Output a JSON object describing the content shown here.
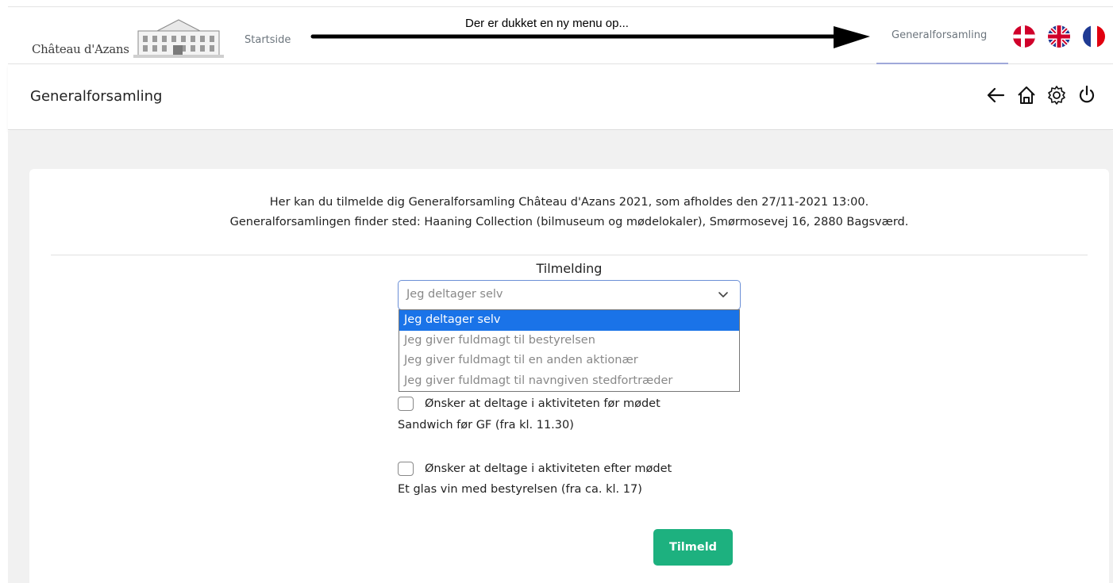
{
  "nav": {
    "logo_text": "Château d'Azans",
    "startside": "Startside",
    "active_item": "Generalforsamling",
    "annotation": "Der er dukket en ny menu op..."
  },
  "header": {
    "title": "Generalforsamling",
    "icons": [
      "back-arrow-icon",
      "home-icon",
      "settings-icon",
      "power-icon"
    ]
  },
  "intro": {
    "line1": "Her kan du tilmelde dig Generalforsamling Château d'Azans 2021, som afholdes den 27/11-2021 13:00.",
    "line2": "Generalforsamlingen finder sted: Haaning Collection (bilmuseum og mødelokaler), Smørmosevej 16, 2880 Bagsværd."
  },
  "form": {
    "tilmelding_label": "Tilmelding",
    "selected": "Jeg deltager selv",
    "options": [
      "Jeg deltager selv",
      "Jeg giver fuldmagt til bestyrelsen",
      "Jeg giver fuldmagt til en anden aktionær",
      "Jeg giver fuldmagt til navngiven stedfortræder"
    ],
    "activity_before": {
      "label": "Ønsker at deltage i aktiviteten før mødet",
      "desc": "Sandwich før GF (fra kl. 11.30)",
      "checked": false
    },
    "activity_after": {
      "label": "Ønsker at deltage i aktiviteten efter mødet",
      "desc": "Et glas vin med bestyrelsen (fra ca. kl. 17)",
      "checked": false
    },
    "submit_label": "Tilmeld"
  },
  "colors": {
    "accent_green": "#1db17f",
    "select_highlight": "#1a73e8",
    "active_underline": "#9fa8da"
  }
}
